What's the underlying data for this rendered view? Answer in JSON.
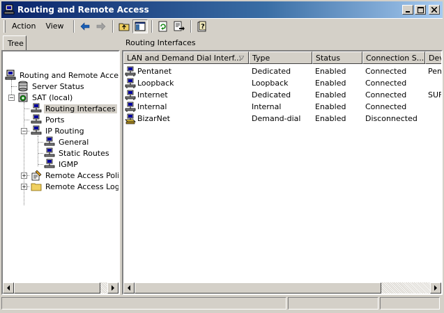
{
  "window": {
    "title": "Routing and Remote Access"
  },
  "menu": {
    "action": "Action",
    "view": "View"
  },
  "tree": {
    "tab_label": "Tree",
    "root": "Routing and Remote Access",
    "server_status": "Server Status",
    "server": "SAT (local)",
    "routing_interfaces": "Routing Interfaces",
    "ports": "Ports",
    "ip_routing": "IP Routing",
    "general": "General",
    "static_routes": "Static Routes",
    "igmp": "IGMP",
    "remote_access_policies": "Remote Access Policie",
    "remote_access_logging": "Remote Access Loggir"
  },
  "list": {
    "title": "Routing Interfaces",
    "columns": [
      "LAN and Demand Dial Interf...",
      "Type",
      "Status",
      "Connection S...",
      "Dev"
    ],
    "rows": [
      {
        "name": "Pentanet",
        "type": "Dedicated",
        "status": "Enabled",
        "connection": "Connected",
        "device": "Pen"
      },
      {
        "name": "Loopback",
        "type": "Loopback",
        "status": "Enabled",
        "connection": "Connected",
        "device": ""
      },
      {
        "name": "Internet",
        "type": "Dedicated",
        "status": "Enabled",
        "connection": "Connected",
        "device": "SUF"
      },
      {
        "name": "Internal",
        "type": "Internal",
        "status": "Enabled",
        "connection": "Connected",
        "device": ""
      },
      {
        "name": "BizarNet",
        "type": "Demand-dial",
        "status": "Enabled",
        "connection": "Disconnected",
        "device": ""
      }
    ]
  },
  "icons": {
    "app": "routing-app-icon",
    "interface": "network-interface-icon",
    "demand_dial": "demand-dial-icon"
  }
}
